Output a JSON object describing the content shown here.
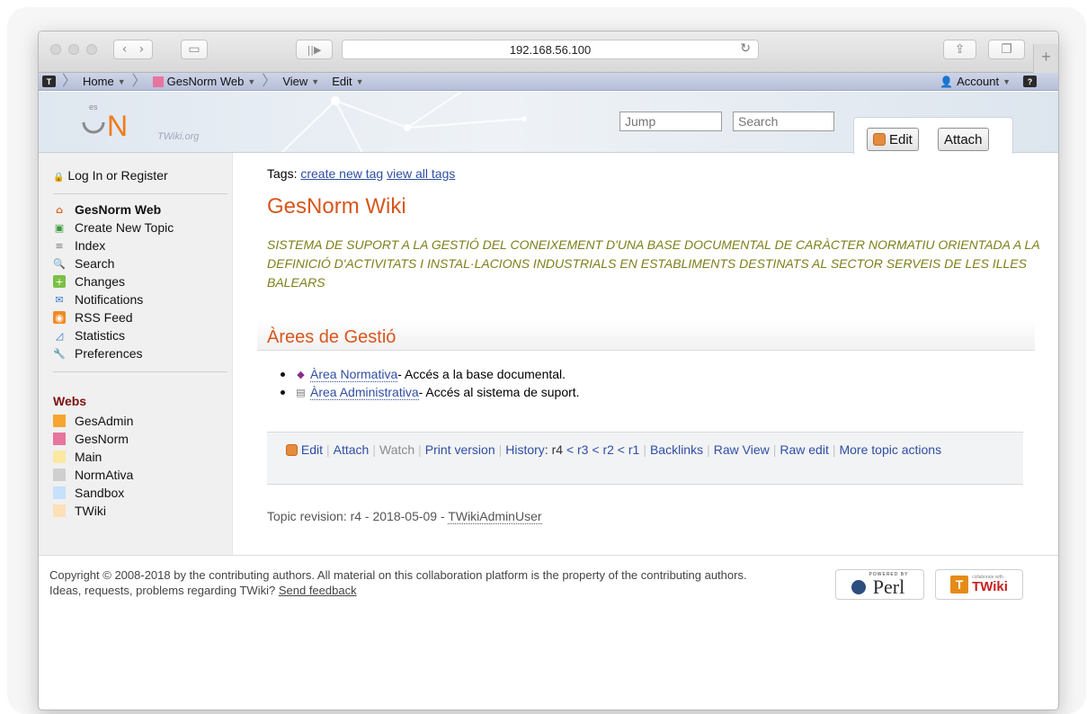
{
  "browser": {
    "url": "192.168.56.100"
  },
  "navbar": {
    "home": "Home",
    "web": "GesNorm Web",
    "view": "View",
    "edit": "Edit",
    "account": "Account"
  },
  "header": {
    "logo_subtext": "TWiki.org",
    "jump_placeholder": "Jump",
    "search_placeholder": "Search",
    "edit_button": "Edit",
    "attach_button": "Attach"
  },
  "sidebar": {
    "login": "Log In",
    "or": "or",
    "register": "Register",
    "items": [
      {
        "label": "GesNorm Web",
        "icon": "home-icon",
        "bold": true
      },
      {
        "label": "Create New Topic",
        "icon": "new-topic-icon"
      },
      {
        "label": "Index",
        "icon": "index-icon"
      },
      {
        "label": "Search",
        "icon": "search-icon"
      },
      {
        "label": "Changes",
        "icon": "changes-icon"
      },
      {
        "label": "Notifications",
        "icon": "notify-icon"
      },
      {
        "label": "RSS Feed",
        "icon": "rss-icon"
      },
      {
        "label": "Statistics",
        "icon": "statistics-icon"
      },
      {
        "label": "Preferences",
        "icon": "wrench-icon"
      }
    ],
    "webs_title": "Webs",
    "webs": [
      {
        "label": "GesAdmin",
        "color": "#f7a531"
      },
      {
        "label": "GesNorm",
        "color": "#e874a0"
      },
      {
        "label": "Main",
        "color": "#fbe9a3"
      },
      {
        "label": "NormAtiva",
        "color": "#cfcfcf"
      },
      {
        "label": "Sandbox",
        "color": "#c7e0fb"
      },
      {
        "label": "TWiki",
        "color": "#fde0b8"
      }
    ]
  },
  "main": {
    "tags_label": "Tags:",
    "tag_create": "create new tag",
    "tag_view_all": "view all tags",
    "title": "GesNorm Wiki",
    "subtitle": "SISTEMA DE SUPORT A LA GESTIÓ DEL CONEIXEMENT D'UNA BASE DOCUMENTAL DE CARÀCTER NORMATIU ORIENTADA A LA DEFINICIÓ D'ACTIVITATS I INSTAL·LACIONS INDUSTRIALS EN ESTABLIMENTS DESTINATS AL SECTOR SERVEIS DE LES ILLES BALEARS",
    "section_title": "Àrees de Gestió",
    "links": [
      {
        "label": "Àrea Normativa",
        "desc": " - Accés a la base documental."
      },
      {
        "label": "Àrea Administrativa",
        "desc": " - Accés al sistema de suport."
      }
    ],
    "actions": {
      "edit": "Edit",
      "attach": "Attach",
      "watch": "Watch",
      "print": "Print version",
      "history": "History",
      "r4": "r4",
      "lt": "<",
      "r3": "r3",
      "r2": "r2",
      "r1": "r1",
      "backlinks": "Backlinks",
      "raw_view": "Raw View",
      "raw_edit": "Raw edit",
      "more": "More topic actions"
    },
    "revision_prefix": "Topic revision: r4 - 2018-05-09 - ",
    "revision_user": "TWikiAdminUser"
  },
  "footer": {
    "copyright": "Copyright © 2008-2018 by the contributing authors. All material on this collaboration platform is the property of the contributing authors.",
    "ideas": "Ideas, requests, problems regarding TWiki?",
    "feedback": "Send feedback",
    "perl_badge_top": "POWERED BY",
    "perl_badge": "Perl",
    "twiki_badge_top": "collaborate with",
    "twiki_badge": "TWiki"
  }
}
